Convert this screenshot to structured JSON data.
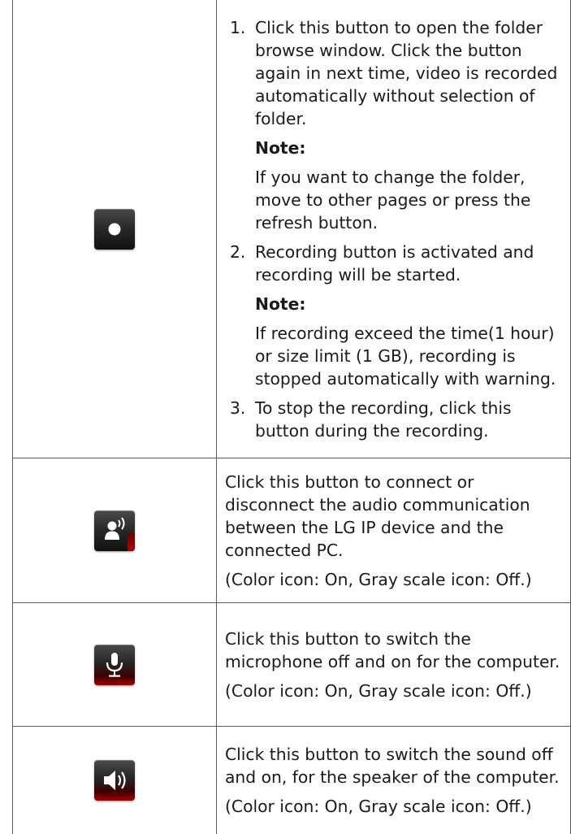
{
  "record": {
    "steps": [
      {
        "num": "1.",
        "text": "Click this button to open the folder browse window. Click the button again in next time, video is recorded automatically without selection of folder.",
        "note_title": "Note:",
        "note_text": "If you want to change the folder, move to other pages or press the refresh button."
      },
      {
        "num": "2.",
        "text": "Recording button is activated and recording will be started.",
        "note_title": "Note:",
        "note_text": "If recording exceed the time(1 hour) or size limit (1 GB), recording is stopped automatically with warning."
      },
      {
        "num": "3.",
        "text": "To stop the recording, click this button during the recording."
      }
    ]
  },
  "audio": {
    "text": "Click this button to connect or disconnect the audio communication between the LG IP device and the connected PC.",
    "sub": "(Color icon: On, Gray scale icon: Off.)"
  },
  "mic": {
    "text": "Click this button to switch the microphone off and on for the computer.",
    "sub": "(Color icon: On, Gray scale icon: Off.)"
  },
  "speaker": {
    "text": "Click this button to switch the sound off and on, for the speaker of the computer.",
    "sub": "(Color icon: On, Gray scale icon: Off.)"
  },
  "icons": {
    "record": "record-icon",
    "audio": "audio-communication-icon",
    "mic": "microphone-icon",
    "speaker": "speaker-icon"
  },
  "colors": {
    "accent_red": "#b40000",
    "border": "#5a5a5a"
  }
}
